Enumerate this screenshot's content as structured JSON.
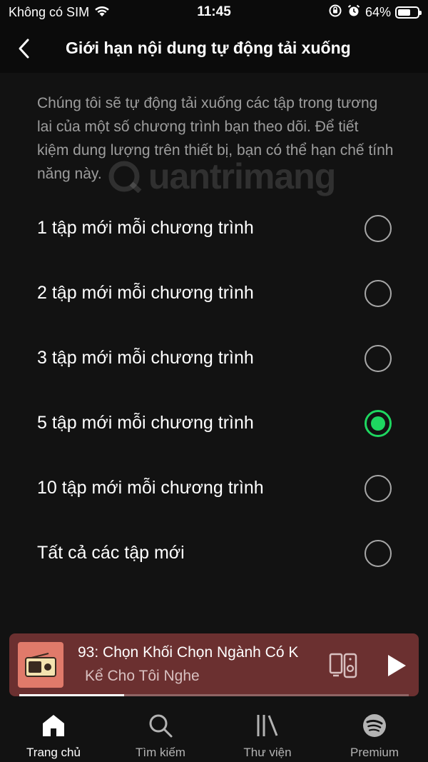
{
  "status_bar": {
    "carrier": "Không có SIM",
    "time": "11:45",
    "battery": "64%",
    "battery_level": 0.64
  },
  "header": {
    "title": "Giới hạn nội dung tự động tải xuống"
  },
  "description": "Chúng tôi sẽ tự động tải xuống các tập trong tương lai của một số chương trình bạn theo dõi. Để tiết kiệm dung lượng trên thiết bị, bạn có thể hạn chế tính năng này.",
  "watermark": "uantrimang",
  "options": [
    {
      "label": "1 tập mới mỗi chương trình",
      "selected": false
    },
    {
      "label": "2 tập mới mỗi chương trình",
      "selected": false
    },
    {
      "label": "3 tập mới mỗi chương trình",
      "selected": false
    },
    {
      "label": "5 tập mới mỗi chương trình",
      "selected": true
    },
    {
      "label": "10 tập mới mỗi chương trình",
      "selected": false
    },
    {
      "label": "Tất cả các tập mới",
      "selected": false
    }
  ],
  "mini_player": {
    "title": "93: Chọn Khối Chọn Ngành Có K",
    "subtitle": "Kể Cho Tôi Nghe",
    "progress": 0.27
  },
  "tabs": [
    {
      "label": "Trang chủ",
      "icon": "home-icon",
      "active": true
    },
    {
      "label": "Tìm kiếm",
      "icon": "search-icon",
      "active": false
    },
    {
      "label": "Thư viện",
      "icon": "library-icon",
      "active": false
    },
    {
      "label": "Premium",
      "icon": "spotify-icon",
      "active": false
    }
  ],
  "colors": {
    "accent": "#1ed760",
    "background": "#121212",
    "mini_player": "#6b3030"
  }
}
